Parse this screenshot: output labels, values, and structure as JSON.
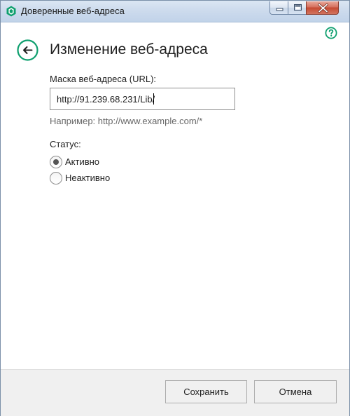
{
  "window": {
    "title": "Доверенные веб-адреса",
    "accent_color": "#0e9f6e"
  },
  "header": {
    "title": "Изменение веб-адреса",
    "back_icon": "arrow-left-icon",
    "help_icon": "question-mark-icon"
  },
  "form": {
    "url_label": "Маска веб-адреса (URL):",
    "url_value": "http://91.239.68.231/Lib/",
    "url_hint": "Например: http://www.example.com/*",
    "status_label": "Статус:",
    "status_options": [
      {
        "label": "Активно",
        "selected": true
      },
      {
        "label": "Неактивно",
        "selected": false
      }
    ]
  },
  "footer": {
    "save_label": "Сохранить",
    "cancel_label": "Отмена"
  }
}
